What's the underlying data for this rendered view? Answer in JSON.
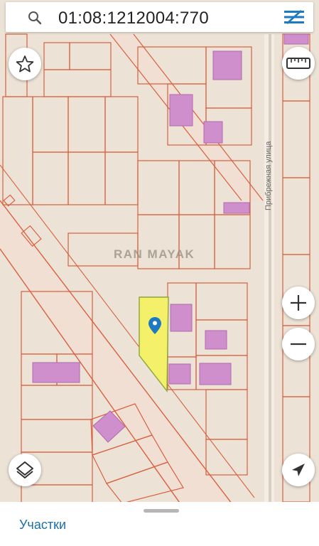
{
  "search": {
    "query": "01:08:1212004:770"
  },
  "map": {
    "watermark": "RAN MAYAK",
    "street_label": "Прибрежная улица",
    "colors": {
      "background": "#ece3d6",
      "road": "#f2dfd4",
      "parcel_border": "#d9603f",
      "building": "#cf8fcc",
      "selected_parcel": "#f4f06a",
      "marker": "#1e79c3"
    },
    "marker_icon": "map-pin-icon"
  },
  "controls": {
    "favorite": "star-icon",
    "ruler": "ruler-icon",
    "zoom_in": "plus-icon",
    "zoom_out": "minus-icon",
    "layers": "layers-icon",
    "location": "navigation-arrow-icon"
  },
  "bottom_panel": {
    "tab_label": "Участки"
  }
}
